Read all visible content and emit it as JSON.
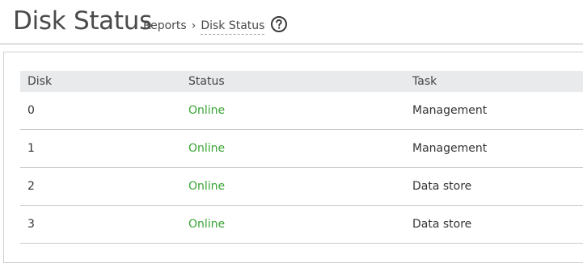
{
  "header": {
    "title": "Disk Status",
    "breadcrumb": {
      "parent": "Reports",
      "separator": "›",
      "current": "Disk Status"
    }
  },
  "table": {
    "columns": [
      "Disk",
      "Status",
      "Task"
    ],
    "rows": [
      {
        "disk": "0",
        "status": "Online",
        "task": "Management"
      },
      {
        "disk": "1",
        "status": "Online",
        "task": "Management"
      },
      {
        "disk": "2",
        "status": "Online",
        "task": "Data store"
      },
      {
        "disk": "3",
        "status": "Online",
        "task": "Data store"
      }
    ]
  },
  "colors": {
    "status_online": "#3aa535",
    "header_bg": "#e8eaeb"
  },
  "icons": {
    "help": "question-circle-icon"
  }
}
